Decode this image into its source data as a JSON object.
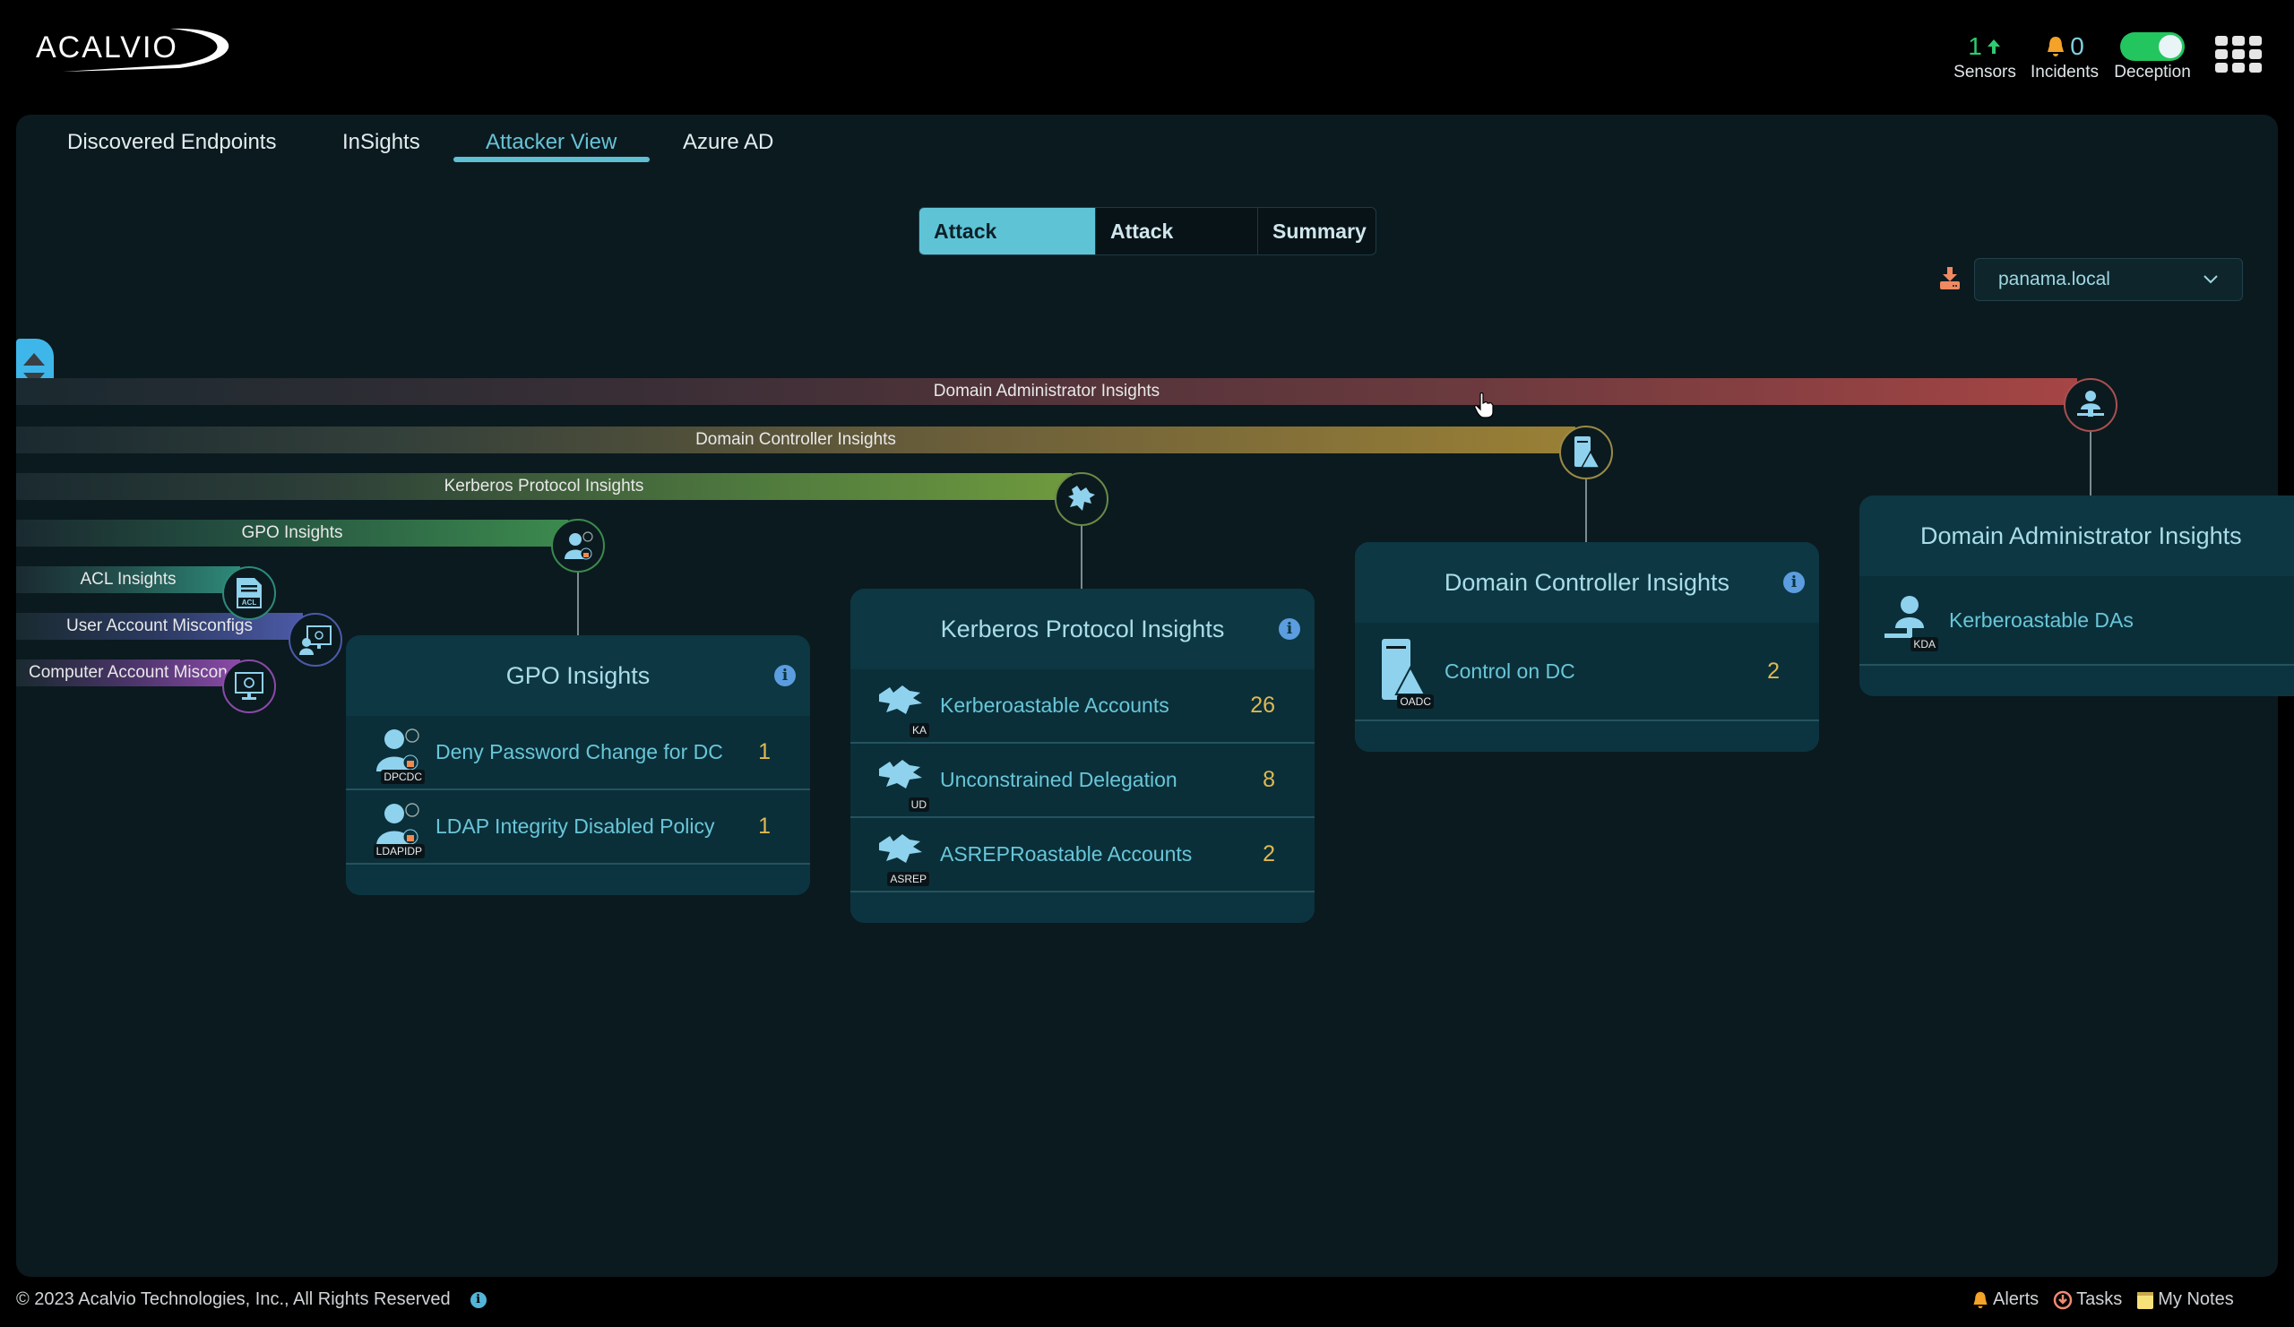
{
  "header": {
    "logo_text": "ACALVIO",
    "sensors": {
      "value": "1",
      "label": "Sensors",
      "icon": "arrow-up-icon"
    },
    "incidents": {
      "value": "0",
      "label": "Incidents",
      "icon": "bell-icon"
    },
    "deception": {
      "label": "Deception",
      "enabled": true
    },
    "apps_icon": "apps-grid-icon"
  },
  "tabs": [
    {
      "label": "Discovered Endpoints",
      "active": false
    },
    {
      "label": "InSights",
      "active": false
    },
    {
      "label": "Attacker View",
      "active": true
    },
    {
      "label": "Azure AD",
      "active": false
    }
  ],
  "view_toggle": [
    {
      "label": "Attack Surfaces",
      "active": true
    },
    {
      "label": "Attack Targets",
      "active": false
    },
    {
      "label": "Summary",
      "active": false
    }
  ],
  "domain_select": {
    "value": "panama.local"
  },
  "attack_path_bars": [
    {
      "label": "Domain Administrator Insights",
      "icon": "domain-admin-icon",
      "color": "#a64545"
    },
    {
      "label": "Domain Controller Insights",
      "icon": "domain-controller-icon",
      "color": "#9a8036"
    },
    {
      "label": "Kerberos Protocol Insights",
      "icon": "kerberos-cerberus-icon",
      "color": "#6f9a3e"
    },
    {
      "label": "GPO Insights",
      "icon": "gpo-user-lock-icon",
      "color": "#3c8a4e"
    },
    {
      "label": "ACL Insights",
      "icon": "acl-file-icon",
      "color": "#2e8a7a"
    },
    {
      "label": "User Account Misconfigs",
      "icon": "user-monitor-gear-icon",
      "color": "#4c5aa8"
    },
    {
      "label": "Computer Account Miscon",
      "icon": "monitor-gear-icon",
      "color": "#8a4aa8"
    }
  ],
  "cards": {
    "gpo": {
      "title": "GPO Insights",
      "rows": [
        {
          "tag": "DPCDC",
          "label": "Deny Password Change for DC",
          "count": "1"
        },
        {
          "tag": "LDAPIDP",
          "label": "LDAP Integrity Disabled Policy",
          "count": "1"
        }
      ]
    },
    "kerberos": {
      "title": "Kerberos Protocol Insights",
      "rows": [
        {
          "tag": "KA",
          "label": "Kerberoastable Accounts",
          "count": "26"
        },
        {
          "tag": "UD",
          "label": "Unconstrained Delegation",
          "count": "8"
        },
        {
          "tag": "ASREP",
          "label": "ASREPRoastable Accounts",
          "count": "2"
        }
      ]
    },
    "domain_controller": {
      "title": "Domain Controller Insights",
      "rows": [
        {
          "tag": "OADC",
          "label": "Control on DC",
          "count": "2"
        }
      ]
    },
    "domain_admin": {
      "title": "Domain Administrator Insights",
      "rows": [
        {
          "tag": "KDA",
          "label": "Kerberoastable DAs",
          "count": ""
        }
      ]
    }
  },
  "footer": {
    "copyright": "© 2023 Acalvio Technologies, Inc., All Rights Reserved",
    "links": [
      {
        "label": "Alerts",
        "icon": "bell-icon"
      },
      {
        "label": "Tasks",
        "icon": "download-circle-icon"
      },
      {
        "label": "My Notes",
        "icon": "sticky-note-icon"
      }
    ]
  }
}
